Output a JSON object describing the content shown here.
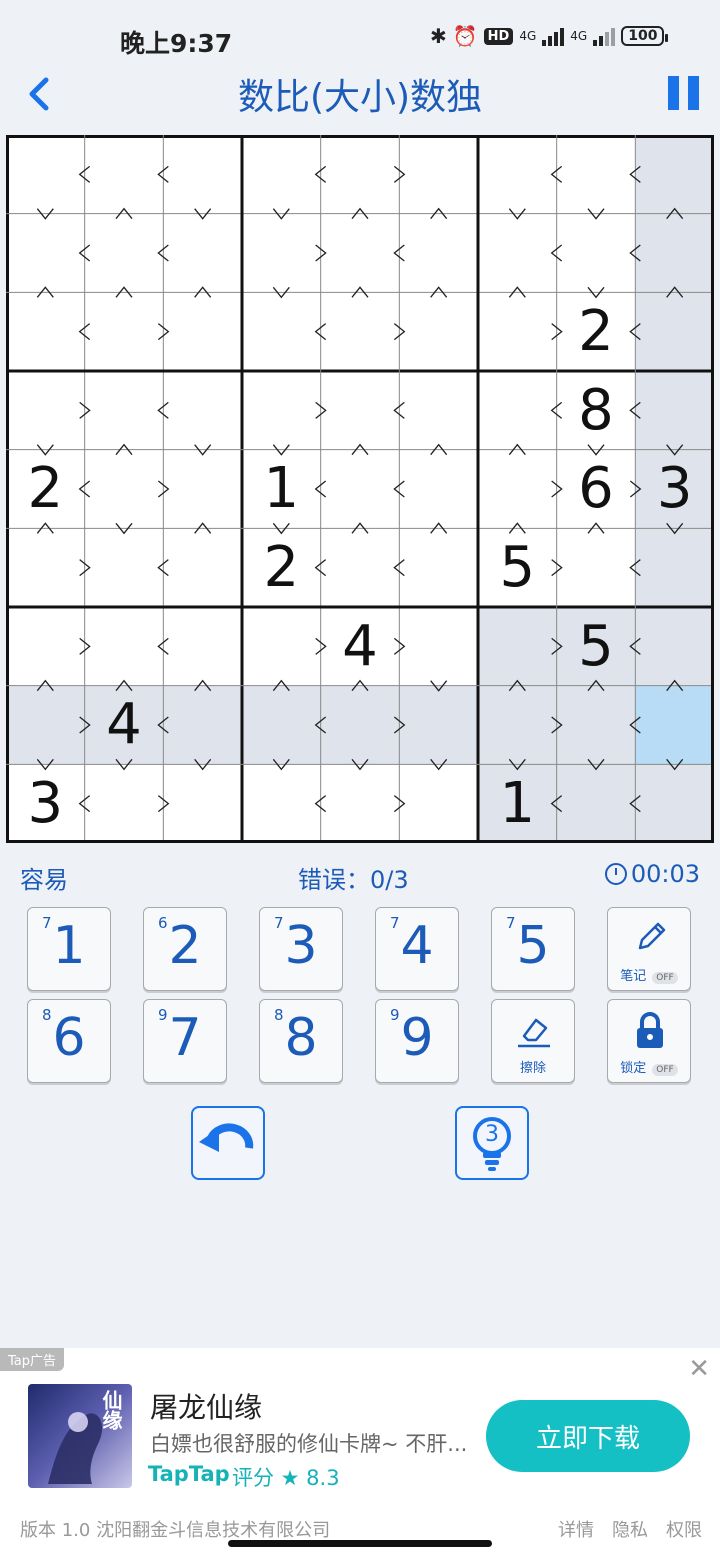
{
  "status": {
    "time": "晚上9:37",
    "hd": "HD",
    "net1": "4G",
    "net2": "4G",
    "battery": "100"
  },
  "header": {
    "title": "数比(大小)数独",
    "back_icon": "chevron-left-icon",
    "pause_icon": "pause-icon"
  },
  "grid": {
    "givens": [
      "........2",
      "..2......",
      "......8..",
      "2...1..63",
      "....2.5..",
      "....4..5.",
      ".4.......",
      "3.....1.."
    ],
    "rows": [
      "000000000",
      "000000000",
      "000000020",
      "000000080",
      "200100063",
      "000200500",
      "000040050",
      "040000000",
      "300000100"
    ],
    "h_signs": [
      "<<<><<",
      "<<><<<",
      "<><>><",
      "><><<<",
      "<><<>>",
      "><<<><",
      "><>>><",
      "><<>><",
      "<><><<"
    ],
    "v_signs": [
      "v^vv^^vv^",
      "^^^v^^^v^",
      "v^vv^^^vv",
      "^v^v^^^^v",
      "^^^^^v^^^",
      "vvvvvvvvv",
      "vvvvvvvvv",
      "v^vvv^^vv"
    ],
    "highlight_color": "#dfe4ec",
    "selected_color": "#b9dcf6"
  },
  "info": {
    "difficulty": "容易",
    "errors": "错误：0/3",
    "timer": "00:03"
  },
  "keypad": {
    "keys": [
      {
        "num": "1",
        "count": "7"
      },
      {
        "num": "2",
        "count": "6"
      },
      {
        "num": "3",
        "count": "7"
      },
      {
        "num": "4",
        "count": "7"
      },
      {
        "num": "5",
        "count": "7"
      },
      {
        "num": "6",
        "count": "8"
      },
      {
        "num": "7",
        "count": "9"
      },
      {
        "num": "8",
        "count": "8"
      },
      {
        "num": "9",
        "count": "9"
      }
    ],
    "notes_label": "笔记",
    "notes_state": "OFF",
    "erase_label": "擦除",
    "lock_label": "锁定",
    "lock_state": "OFF"
  },
  "actions": {
    "undo_icon": "undo-icon",
    "hint_icon": "lightbulb-icon",
    "hint_count": "3"
  },
  "ad": {
    "tag": "Tap广告",
    "title": "屠龙仙缘",
    "desc": "白嫖也很舒服的修仙卡牌~ 不肝...",
    "brand": "TapTap",
    "rating_text": "评分 ★ 8.3",
    "button": "立即下载",
    "close_icon": "close-icon",
    "art_text": "仙缘"
  },
  "footer": {
    "version": "版本 1.0   沈阳翻金斗信息技术有限公司",
    "details": "详情",
    "privacy": "隐私",
    "permissions": "权限"
  }
}
